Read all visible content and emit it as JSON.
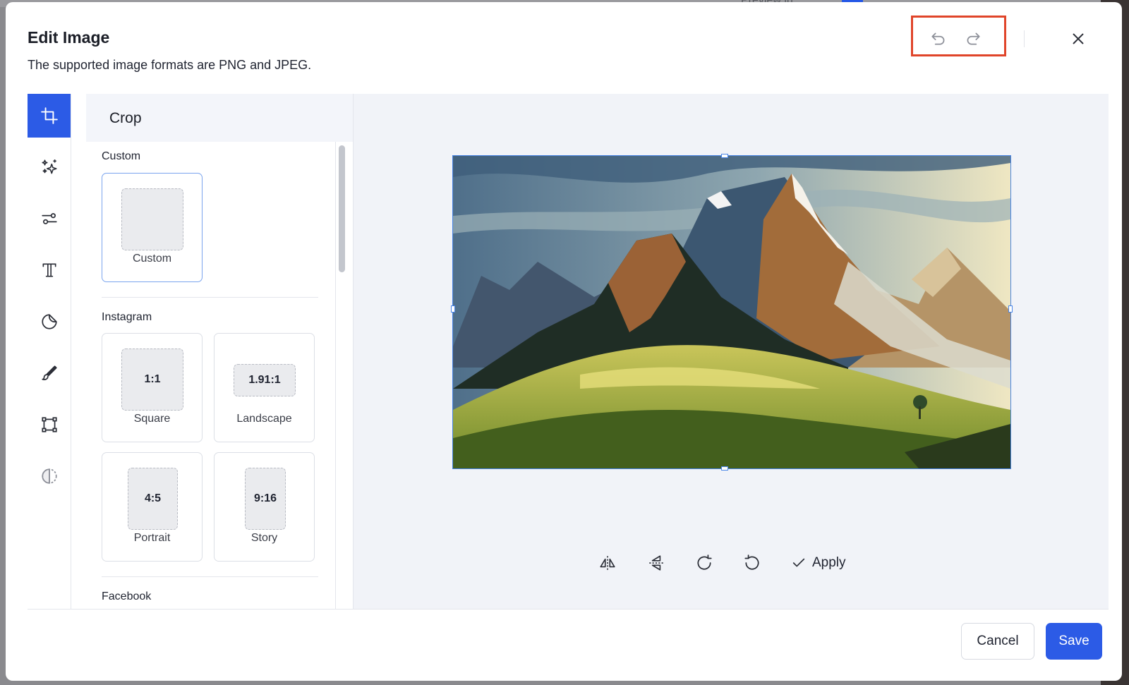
{
  "background": {
    "text": "Preview in"
  },
  "dialog": {
    "title": "Edit Image",
    "subtitle": "The supported image formats are PNG and JPEG.",
    "actions": {
      "undo_icon": "undo-icon",
      "redo_icon": "redo-icon",
      "close_icon": "close-icon"
    }
  },
  "tools": [
    {
      "name": "crop",
      "icon": "crop-icon",
      "active": true
    },
    {
      "name": "ai-magic",
      "icon": "sparkles-icon",
      "active": false
    },
    {
      "name": "adjust",
      "icon": "sliders-icon",
      "active": false
    },
    {
      "name": "text",
      "icon": "text-icon",
      "active": false
    },
    {
      "name": "sticker",
      "icon": "sticker-icon",
      "active": false
    },
    {
      "name": "draw",
      "icon": "brush-icon",
      "active": false
    },
    {
      "name": "frame",
      "icon": "frame-icon",
      "active": false
    },
    {
      "name": "filter",
      "icon": "contrast-icon",
      "active": false
    }
  ],
  "panel": {
    "title": "Crop",
    "sections": {
      "custom": {
        "label": "Custom",
        "items": [
          {
            "ratio": "",
            "label": "Custom",
            "selected": true
          }
        ]
      },
      "instagram": {
        "label": "Instagram",
        "items": [
          {
            "ratio": "1:1",
            "label": "Square"
          },
          {
            "ratio": "1.91:1",
            "label": "Landscape"
          },
          {
            "ratio": "4:5",
            "label": "Portrait"
          },
          {
            "ratio": "9:16",
            "label": "Story"
          }
        ]
      },
      "facebook": {
        "label": "Facebook"
      }
    }
  },
  "canvas": {
    "image_alt": "Mountain landscape illustration",
    "tools": {
      "flip_horizontal_icon": "flip-horizontal-icon",
      "flip_vertical_icon": "flip-vertical-icon",
      "rotate_right_icon": "rotate-clockwise-icon",
      "rotate_left_icon": "rotate-counterclockwise-icon",
      "apply_label": "Apply"
    }
  },
  "footer": {
    "cancel_label": "Cancel",
    "save_label": "Save"
  },
  "colors": {
    "accent": "#2c5be6",
    "highlight_box": "#e0452a",
    "canvas_bg": "#f1f3f8"
  }
}
